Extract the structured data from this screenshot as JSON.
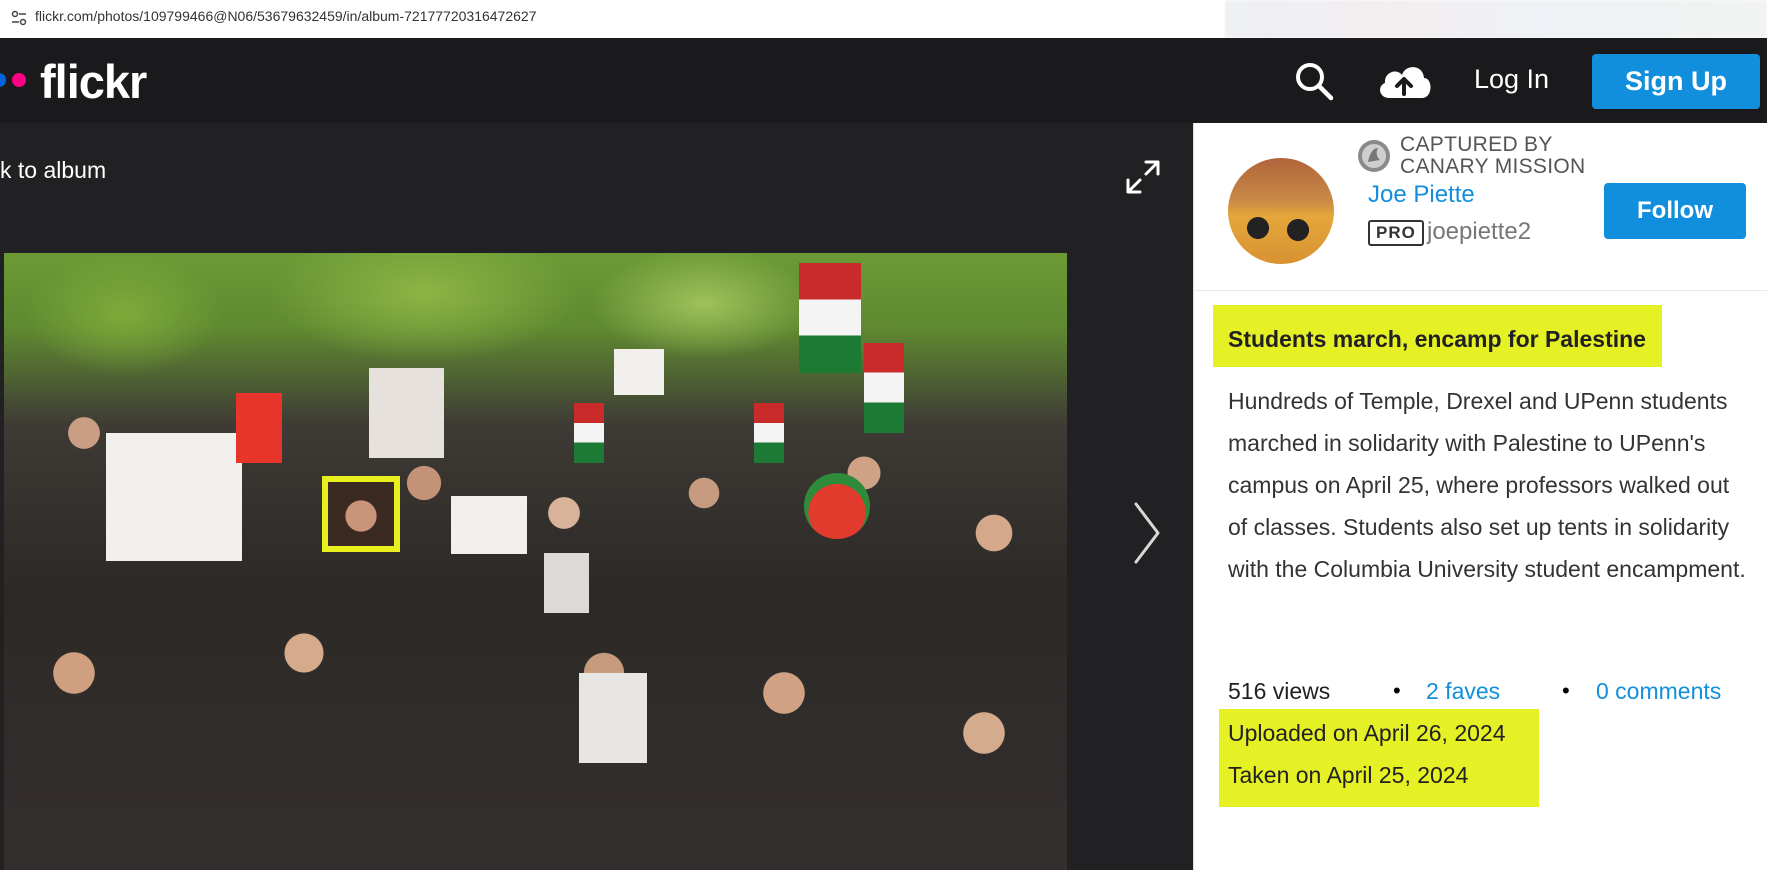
{
  "browser": {
    "url": "flickr.com/photos/109799466@N06/53679632459/in/album-72177720316472627"
  },
  "nav": {
    "logo": "flickr",
    "login": "Log In",
    "signup": "Sign Up"
  },
  "photo_view": {
    "back_link": "k to album"
  },
  "owner": {
    "watermark_line1": "CAPTURED BY",
    "watermark_line2": "CANARY MISSION",
    "name": "Joe Piette",
    "badge": "PRO",
    "handle": "joepiette2",
    "follow": "Follow"
  },
  "photo": {
    "title": "Students march, encamp for Palestine",
    "description": "Hundreds of Temple, Drexel and UPenn students marched in solidarity with Palestine to UPenn's campus on April 25, where professors walked out of classes. Students also set up tents in solidarity with the Columbia University student encampment.",
    "views": "516 views",
    "faves": "2 faves",
    "comments": "0 comments",
    "uploaded": "Uploaded on April 26, 2024",
    "taken": "Taken on April 25, 2024"
  },
  "colors": {
    "brand_blue": "#128fdc",
    "highlight": "#e5f025",
    "nav_bg": "#1a1a1d"
  }
}
